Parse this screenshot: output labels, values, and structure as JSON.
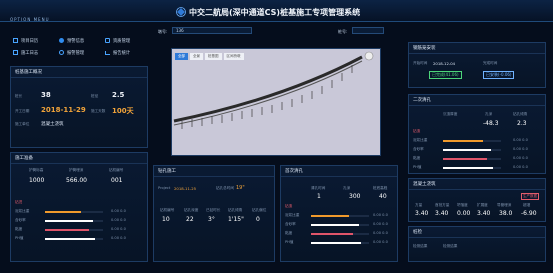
{
  "header": {
    "option_menu": "OPTION  MENU",
    "title": "中交二航局(深中通道CS)桩基施工专项管理系统"
  },
  "menu": [
    {
      "label": "项目日历",
      "icon": "calendar-icon"
    },
    {
      "label": "预警信息",
      "icon": "alert-icon"
    },
    {
      "label": "资质管理",
      "icon": "certificate-icon"
    },
    {
      "label": "施工日志",
      "icon": "log-icon"
    },
    {
      "label": "报警管理",
      "icon": "alarm-icon"
    },
    {
      "label": "报告统计",
      "icon": "report-icon"
    },
    {
      "label": "系统管理",
      "icon": "gear-icon"
    }
  ],
  "toolbar": {
    "pier_label": "墩号:",
    "pier_value": "136",
    "pile_label": "桩号:"
  },
  "view_tabs": [
    "全部",
    "全景",
    "桩基图",
    "区间桥墩"
  ],
  "pile_overview": {
    "title": "桩基施工概况",
    "total_label": "桩长",
    "total": "38",
    "pile_diam_label": "桩径",
    "pile_diam": "2.5",
    "date_label": "开工日期",
    "date": "2018-11-29",
    "days_label": "施工天数",
    "days": "100天",
    "unit_label": "施工单位",
    "unit": "混凝土浇筑"
  },
  "construction_prep": {
    "title": "施工准备",
    "col1_label": "护筒标高",
    "col1": "1000",
    "col2_label": "护筒埋深",
    "col2": "566.00",
    "col3_label": "钻机编号",
    "col3": "001",
    "items": [
      {
        "label": "钻进"
      },
      {
        "label": "泥浆比重",
        "value": "0.00 0.0"
      },
      {
        "label": "含砂率",
        "value": "0.00 0.0"
      },
      {
        "label": "黏度",
        "value": "0.00 0.0"
      },
      {
        "label": "PH值",
        "value": "0.00 0.0"
      }
    ]
  },
  "drilling": {
    "title": "钻孔施工",
    "project_label": "Project",
    "project_date": "2018-11-25",
    "duration_label": "钻孔总时间",
    "duration": "19\"",
    "col_labels": [
      "钻机编号",
      "钻孔深度",
      "已钻时长",
      "钻孔倾角",
      "钻孔偏位"
    ],
    "cols": [
      "10",
      "22",
      "3°",
      "1'15\"",
      "0"
    ]
  },
  "first_cleaning": {
    "title": "首次清孔",
    "col_labels": [
      "清孔时间",
      "孔深",
      "桩底高程"
    ],
    "cols": [
      "1",
      "300",
      "40"
    ],
    "items": [
      {
        "label": "钻渣"
      },
      {
        "label": "泥浆比重",
        "value": "0.00 0.0"
      },
      {
        "label": "含砂率",
        "value": "0.00 0.0"
      },
      {
        "label": "黏度",
        "value": "0.00 0.0"
      },
      {
        "label": "PH值",
        "value": "0.00 0.0"
      }
    ]
  },
  "pile_cage": {
    "title": "钢筋笼安装",
    "start_label": "开始时间",
    "start": "2018-12-04",
    "finish_label": "完成时间",
    "status": "已完成(41.06)",
    "status2": "已安装(-0.06)"
  },
  "second_cleaning": {
    "title": "二次清孔",
    "col_labels": [
      "沉渣厚度",
      "孔深",
      "钻孔倾角"
    ],
    "cols": [
      "-48.3",
      "2.3"
    ],
    "items": [
      {
        "label": "钻渣"
      },
      {
        "label": "泥浆比重",
        "value": "0.00 0.0"
      },
      {
        "label": "含砂率",
        "value": "0.00 0.0"
      },
      {
        "label": "黏度",
        "value": "0.00 0.0"
      },
      {
        "label": "PH值",
        "value": "0.00 0.0"
      }
    ]
  },
  "concrete": {
    "title": "混凝土浇筑",
    "badge": "生产数据",
    "col_labels": [
      "方量",
      "首批方量",
      "坍落度",
      "扩展度",
      "导管埋深",
      "超灌"
    ],
    "cols": [
      "3.40",
      "3.40",
      "0.00",
      "3.40",
      "38.0",
      "-6.90"
    ]
  },
  "bottom_panel": {
    "title": "桩检",
    "row_label": "检测结果",
    "row_value": "检测结果"
  }
}
